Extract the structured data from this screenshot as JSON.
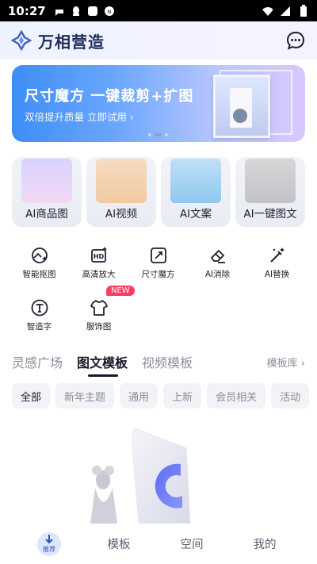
{
  "status_bar": {
    "time": "10:27"
  },
  "header": {
    "title": "万相营造"
  },
  "banner": {
    "title": "尺寸魔方 一键裁剪+扩图",
    "subtitle": "双倍提升质量 立即试用 ›"
  },
  "feature_cards": [
    {
      "label": "AI商品图"
    },
    {
      "label": "AI视频"
    },
    {
      "label": "AI文案"
    },
    {
      "label": "AI一键图文"
    }
  ],
  "tools_row1": [
    {
      "label": "智能抠图",
      "icon": "smart-cutout-icon"
    },
    {
      "label": "高清放大",
      "icon": "hd-upscale-icon"
    },
    {
      "label": "尺寸魔方",
      "icon": "resize-icon"
    },
    {
      "label": "AI消除",
      "icon": "eraser-icon"
    },
    {
      "label": "AI替换",
      "icon": "magic-replace-icon"
    }
  ],
  "tools_row2": [
    {
      "label": "智造字",
      "icon": "text-icon"
    },
    {
      "label": "服饰图",
      "icon": "clothing-icon"
    }
  ],
  "new_badge": "NEW",
  "tabs": [
    {
      "label": "灵感广场"
    },
    {
      "label": "图文模板"
    },
    {
      "label": "视频模板"
    }
  ],
  "tabs_more": "模板库 ›",
  "chips": [
    {
      "label": "全部"
    },
    {
      "label": "新年主题"
    },
    {
      "label": "通用"
    },
    {
      "label": "上新"
    },
    {
      "label": "会员相关"
    },
    {
      "label": "活动"
    }
  ],
  "bottom_nav": {
    "home": "推荐",
    "templates": "模板",
    "space": "空间",
    "mine": "我的"
  },
  "colors": {
    "accent": "#3354b8",
    "badge": "#ff3d64",
    "banner_start": "#3d8ef6",
    "banner_end": "#d9c8ff"
  }
}
